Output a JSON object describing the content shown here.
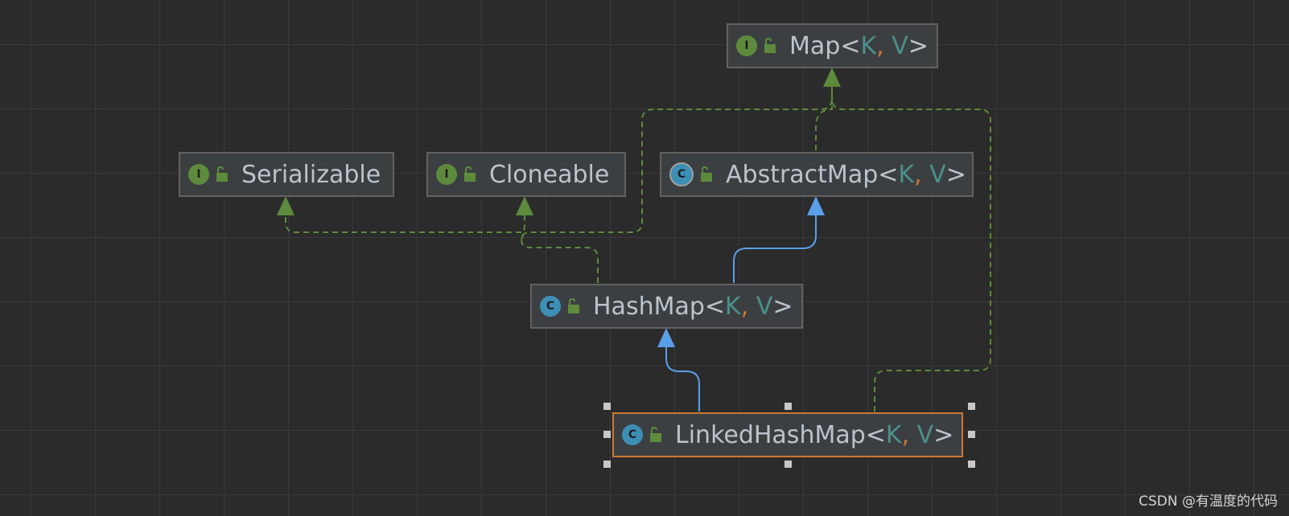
{
  "diagram": {
    "nodes": [
      {
        "id": "map",
        "name": "Map",
        "kind": "interface",
        "kind_letter": "I",
        "type_params": [
          "K",
          "V"
        ]
      },
      {
        "id": "serializable",
        "name": "Serializable",
        "kind": "interface",
        "kind_letter": "I"
      },
      {
        "id": "cloneable",
        "name": "Cloneable",
        "kind": "interface",
        "kind_letter": "I"
      },
      {
        "id": "abstractmap",
        "name": "AbstractMap",
        "kind": "abstract class",
        "kind_letter": "C",
        "type_params": [
          "K",
          "V"
        ]
      },
      {
        "id": "hashmap",
        "name": "HashMap",
        "kind": "class",
        "kind_letter": "C",
        "type_params": [
          "K",
          "V"
        ]
      },
      {
        "id": "linkedhashmap",
        "name": "LinkedHashMap",
        "kind": "class",
        "kind_letter": "C",
        "type_params": [
          "K",
          "V"
        ],
        "selected": true
      }
    ],
    "edges": [
      {
        "from": "abstractmap",
        "to": "map",
        "relation": "implements"
      },
      {
        "from": "hashmap",
        "to": "abstractmap",
        "relation": "extends"
      },
      {
        "from": "hashmap",
        "to": "map",
        "relation": "implements"
      },
      {
        "from": "hashmap",
        "to": "cloneable",
        "relation": "implements"
      },
      {
        "from": "hashmap",
        "to": "serializable",
        "relation": "implements"
      },
      {
        "from": "linkedhashmap",
        "to": "hashmap",
        "relation": "extends"
      },
      {
        "from": "linkedhashmap",
        "to": "map",
        "relation": "implements"
      }
    ],
    "colors": {
      "implements_edge": "#5d8a3c",
      "extends_edge": "#5a9ee8",
      "selected_border": "#cc7832"
    }
  },
  "watermark": "CSDN @有温度的代码"
}
